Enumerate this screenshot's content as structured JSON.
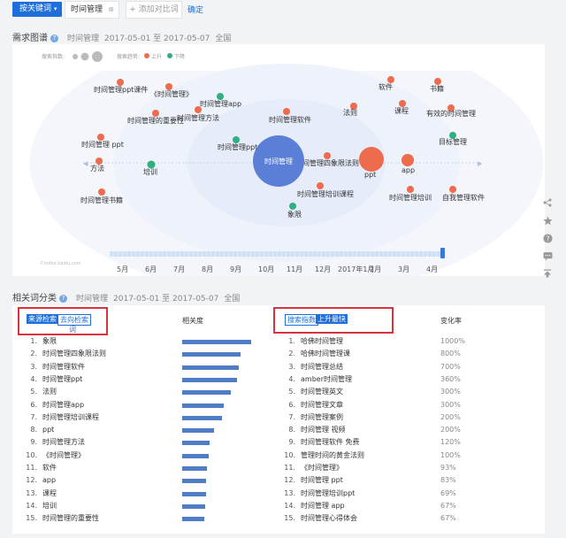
{
  "topbar": {
    "keyword_button": "按关键词",
    "keyword_tab": "时间管理",
    "add_compare": "+ 添加对比词",
    "confirm": "确定"
  },
  "demand_graph": {
    "title": "需求图谱",
    "keyword": "时间管理",
    "date_range": "2017-05-01 至 2017-05-07",
    "region": "全国",
    "legend": {
      "search_index_label": "搜索指数:",
      "trend_label": "搜索趋势:",
      "rise_label": "上升",
      "fall_label": "下降"
    },
    "colors": {
      "rise": "#ee6b4d",
      "fall": "#2fb07f",
      "center": "#5b7fd6"
    },
    "center_label": "时间管理",
    "nodes": [
      {
        "label": "时间管理ppt课件",
        "trend": "rise"
      },
      {
        "label": "《时间管理》",
        "trend": "rise"
      },
      {
        "label": "时间管理app",
        "trend": "fall"
      },
      {
        "label": "时间管理的重要性",
        "trend": "rise"
      },
      {
        "label": "时间管理方法",
        "trend": "rise"
      },
      {
        "label": "时间管理软件",
        "trend": "rise"
      },
      {
        "label": "法则",
        "trend": "rise"
      },
      {
        "label": "软件",
        "trend": "rise"
      },
      {
        "label": "课程",
        "trend": "rise"
      },
      {
        "label": "书籍",
        "trend": "rise"
      },
      {
        "label": "有效的时间管理",
        "trend": "rise"
      },
      {
        "label": "目标管理",
        "trend": "fall"
      },
      {
        "label": "时间管理 ppt",
        "trend": "rise"
      },
      {
        "label": "时间管理ppt",
        "trend": "fall"
      },
      {
        "label": "方法",
        "trend": "rise"
      },
      {
        "label": "培训",
        "trend": "fall"
      },
      {
        "label": "时间管理四象限法则",
        "trend": "rise"
      },
      {
        "label": "ppt",
        "trend": "rise"
      },
      {
        "label": "app",
        "trend": "rise"
      },
      {
        "label": "时间管理书籍",
        "trend": "rise"
      },
      {
        "label": "时间管理培训课程",
        "trend": "rise"
      },
      {
        "label": "时间管理培训",
        "trend": "rise"
      },
      {
        "label": "自我管理软件",
        "trend": "rise"
      },
      {
        "label": "象限",
        "trend": "fall"
      }
    ],
    "timeline_labels": [
      "5月",
      "6月",
      "7月",
      "8月",
      "9月",
      "10月",
      "11月",
      "12月",
      "2017年1月",
      "2月",
      "3月",
      "4月"
    ],
    "watermark": "©index.baidu.com"
  },
  "related": {
    "title": "相关词分类",
    "keyword": "时间管理",
    "date_range": "2017-05-01 至 2017-05-07",
    "region": "全国",
    "left_tabs": {
      "active": "来源检索",
      "other": "去向检索",
      "other_wrap": "词"
    },
    "right_tabs": {
      "first": "搜索指数",
      "second": "上升最快"
    },
    "relevance_header": "相关度",
    "change_header": "变化率",
    "left_rows": [
      {
        "idx": "1.",
        "word": "象限",
        "relevance": 1.0
      },
      {
        "idx": "2.",
        "word": "时间管理四象限法则",
        "relevance": 0.84
      },
      {
        "idx": "3.",
        "word": "时间管理软件",
        "relevance": 0.82
      },
      {
        "idx": "4.",
        "word": "时间管理ppt",
        "relevance": 0.8
      },
      {
        "idx": "5.",
        "word": "法则",
        "relevance": 0.7
      },
      {
        "idx": "6.",
        "word": "时间管理app",
        "relevance": 0.6
      },
      {
        "idx": "7.",
        "word": "时间管理培训课程",
        "relevance": 0.58
      },
      {
        "idx": "8.",
        "word": "ppt",
        "relevance": 0.46
      },
      {
        "idx": "9.",
        "word": "时间管理方法",
        "relevance": 0.4
      },
      {
        "idx": "10.",
        "word": "《时间管理》",
        "relevance": 0.38
      },
      {
        "idx": "11.",
        "word": "软件",
        "relevance": 0.36
      },
      {
        "idx": "12.",
        "word": "app",
        "relevance": 0.35
      },
      {
        "idx": "13.",
        "word": "课程",
        "relevance": 0.34
      },
      {
        "idx": "14.",
        "word": "培训",
        "relevance": 0.33
      },
      {
        "idx": "15.",
        "word": "时间管理的重要性",
        "relevance": 0.32
      }
    ],
    "right_rows": [
      {
        "idx": "1.",
        "word": "哈佛时间管理",
        "change": "1000%"
      },
      {
        "idx": "2.",
        "word": "哈佛时间管理课",
        "change": "800%"
      },
      {
        "idx": "3.",
        "word": "时间管理总结",
        "change": "700%"
      },
      {
        "idx": "4.",
        "word": "amber时间管理",
        "change": "360%"
      },
      {
        "idx": "5.",
        "word": "时间管理英文",
        "change": "300%"
      },
      {
        "idx": "6.",
        "word": "时间管理文章",
        "change": "300%"
      },
      {
        "idx": "7.",
        "word": "时间管理案例",
        "change": "200%"
      },
      {
        "idx": "8.",
        "word": "时间管理 视频",
        "change": "200%"
      },
      {
        "idx": "9.",
        "word": "时间管理软件 免费",
        "change": "120%"
      },
      {
        "idx": "10.",
        "word": "管理时间的黄金法则",
        "change": "100%"
      },
      {
        "idx": "11.",
        "word": "《时间管理》",
        "change": "93%"
      },
      {
        "idx": "12.",
        "word": "时间管理 ppt",
        "change": "83%"
      },
      {
        "idx": "13.",
        "word": "时间管理培训ppt",
        "change": "69%"
      },
      {
        "idx": "14.",
        "word": "时间管理 app",
        "change": "67%"
      },
      {
        "idx": "15.",
        "word": "时间管理心得体会",
        "change": "67%"
      }
    ]
  },
  "sidebar_icons": [
    "share-icon",
    "star-icon",
    "help-icon",
    "comment-icon",
    "back-to-top-icon"
  ]
}
